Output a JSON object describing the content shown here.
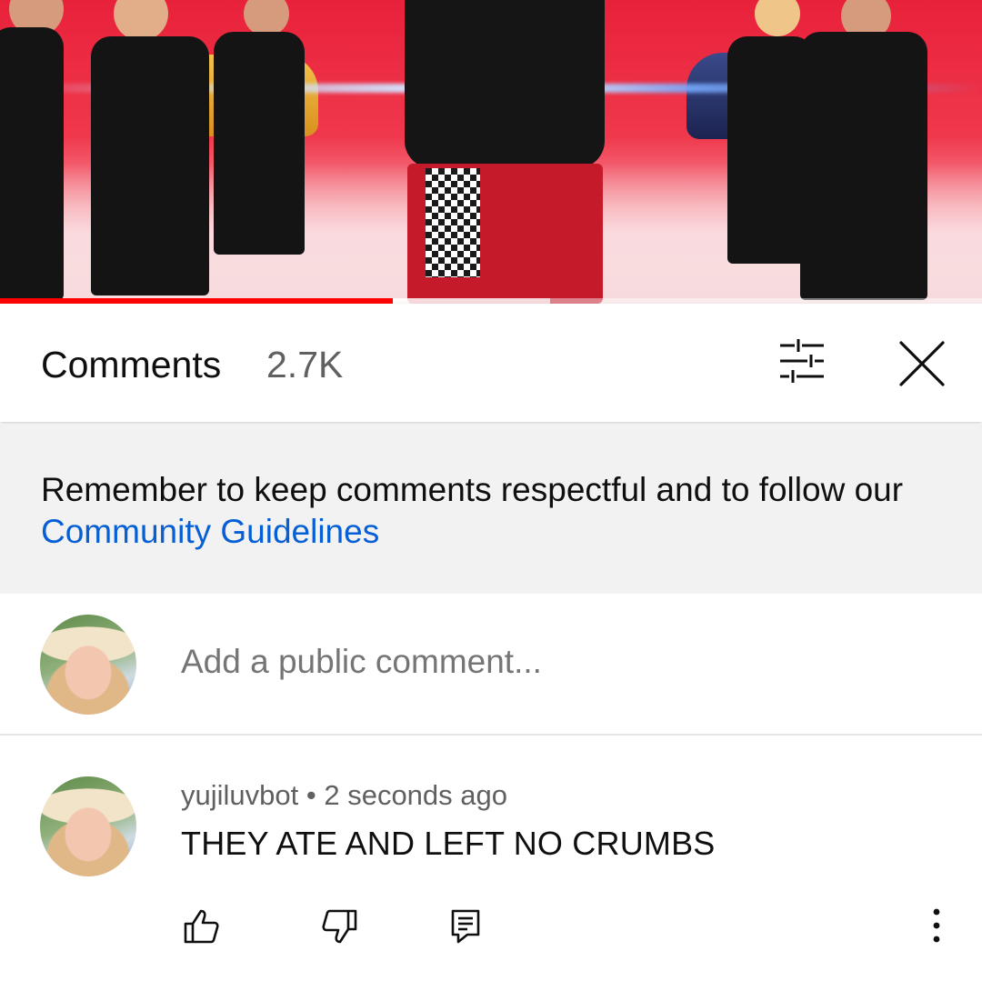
{
  "video": {
    "progress_fraction": 0.4,
    "buffered_fraction": 0.56,
    "progress_color": "#ff0000"
  },
  "comments_header": {
    "title": "Comments",
    "count": "2.7K",
    "filter_icon": "sliders-icon",
    "close_icon": "close-icon"
  },
  "guidelines": {
    "text": "Remember to keep comments respectful and to follow our ",
    "link_text": "Community Guidelines",
    "link_color": "#065fd4"
  },
  "add_comment": {
    "placeholder": "Add a public comment..."
  },
  "comments": [
    {
      "author": "yujiluvbot",
      "separator": " • ",
      "time": "2 seconds ago",
      "text": "THEY ATE AND LEFT NO CRUMBS",
      "actions": {
        "like_icon": "thumbs-up-icon",
        "dislike_icon": "thumbs-down-icon",
        "reply_icon": "reply-icon",
        "more_icon": "more-vert-icon"
      }
    }
  ]
}
